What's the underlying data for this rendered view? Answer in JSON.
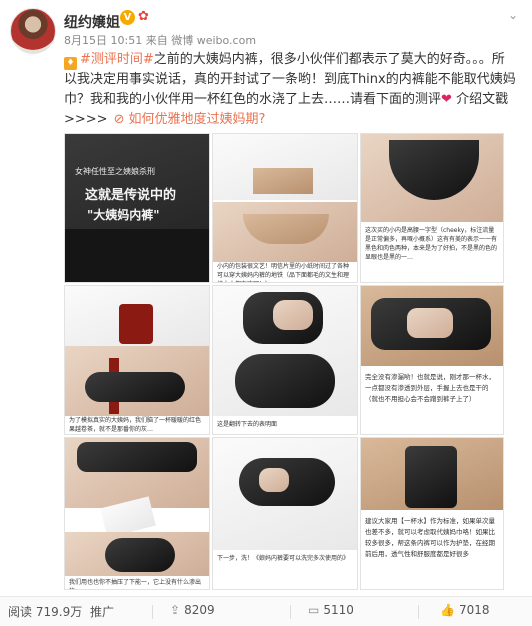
{
  "author": {
    "name": "纽约嬢姐",
    "badge": "V",
    "vip_icon": "gift-icon"
  },
  "meta": {
    "time": "8月15日 10:51",
    "source_prefix": "来自",
    "source": "微博 weibo.com"
  },
  "post": {
    "hashtag": "#测评时间#",
    "text_1": "之前的大姨妈内裤，很多小伙伴们都表示了莫大的好奇。。。所以我决定用事实说话，真的开封试了一条哟！到底Thinx的内裤能不能取代姨妈巾？我和我的小伙伴用一杯红色的水浇了上去……请看下面的测评",
    "heart": "❤",
    "text_2": "介绍文戳 >>>>",
    "link": "如何优雅地度过姨妈期?"
  },
  "images": [
    {
      "name": "image-chalkboard",
      "line1": "女神任性至之姨娘杀刑",
      "line2": "这就是传说中的",
      "line3": "\"大姨妈内裤\""
    },
    {
      "name": "image-unboxing",
      "caption": "小内的包装很文艺！明信片里的小纸时间过了各种可以穿大姨妈内裤的地铁（品下面都毛的文生和理纯人士都在这吧！）"
    },
    {
      "name": "image-underwear-flat",
      "caption": "这次买的小内是高腰一字型（cheeky，标注流量是正常偏多，再嘅小概系）这有有美的表示一一有黑色和肉色两种，本来是为了好拍，不是黑的色的显眼也是黑的一…"
    },
    {
      "name": "image-pour-red",
      "caption": "为了模拟真实的大姨妈，我们脑了一杯暖暖的红色果越卷茶，就不是那番你的灰…"
    },
    {
      "name": "image-flip-hands",
      "caption": "这是翻转下去的表明面"
    },
    {
      "name": "image-mirror-check",
      "caption": "完全没有渗漏哟！也就是说，刚才那一杯水，一点都没有渗透到外层，手握上去也是干的（就也不用担心会不会蹭到裤子上了）"
    },
    {
      "name": "image-wet-towel",
      "caption": "我们用也也你不抽压了下能一，它上没有什么渗出的…"
    },
    {
      "name": "image-water-basin",
      "caption": "下一步，洗！《娘妈内裤要可以洗完多次使用的》"
    },
    {
      "name": "image-closet",
      "caption": "建议大家用【一杯水】作为标准，如果单次量也差不多，就可以考虑取代姨妈巾咯！如果比较多很多，帮这条内裤可以作为护垫，在经期前后用，透气性和舒服度都是好很多"
    }
  ],
  "stats": {
    "read_label": "阅读",
    "read_count": "719.9万",
    "promote": "推广",
    "share_count": "8209",
    "comment_count": "5110",
    "like_count": "7018"
  }
}
